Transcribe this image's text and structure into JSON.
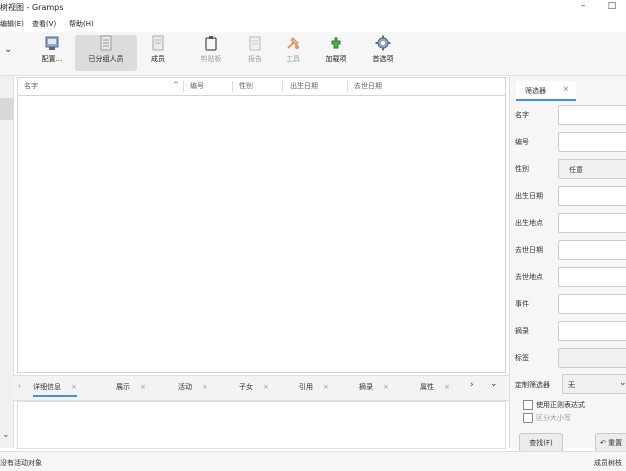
{
  "window": {
    "title": "树视图 - Gramps",
    "minimize": "–",
    "maximize": "□"
  },
  "menu": [
    "编辑(E)",
    "查看(V)",
    "帮助(H)"
  ],
  "toolbar": {
    "left_chevron": "⌄",
    "items": [
      {
        "label": "配置...",
        "icon": "configure-icon",
        "enabled": true
      },
      {
        "label": "已分组人员",
        "icon": "grouped-people-icon",
        "enabled": true,
        "active": true
      },
      {
        "label": "成员",
        "icon": "members-icon",
        "enabled": true
      },
      {
        "label": "剪贴板",
        "icon": "clipboard-icon",
        "enabled": false
      },
      {
        "label": "报告",
        "icon": "report-icon",
        "enabled": false
      },
      {
        "label": "工具",
        "icon": "tools-icon",
        "enabled": false
      },
      {
        "label": "加载项",
        "icon": "addons-icon",
        "enabled": true
      },
      {
        "label": "首选项",
        "icon": "preferences-icon",
        "enabled": true
      }
    ]
  },
  "columns": [
    "名字",
    "编号",
    "性别",
    "出生日期",
    "去世日期"
  ],
  "sort_indicator": "^",
  "bottom_tabs": [
    {
      "label": "详细信息",
      "selected": true
    },
    {
      "label": "展示"
    },
    {
      "label": "活动"
    },
    {
      "label": "子女"
    },
    {
      "label": "引用"
    },
    {
      "label": "摘录"
    },
    {
      "label": "属性"
    }
  ],
  "bottom_nav": {
    "left": "‹",
    "right": "›",
    "menu": "⌄",
    "close": "×"
  },
  "sidebar": {
    "tab_label": "筛选器",
    "fields": [
      "名字",
      "编号",
      "性别",
      "出生日期",
      "出生地点",
      "去世日期",
      "去世地点",
      "事件",
      "摘录",
      "标签"
    ],
    "gender_value": "任意",
    "custom_filter_label": "定制筛选器",
    "custom_filter_value": "无",
    "checkbox_regex": "使用正则表达式",
    "checkbox_case": "区分大小写",
    "find_button": "查找(F)",
    "reset_button": "重置"
  },
  "status": {
    "left": "没有活动对象",
    "right": "成员树枝"
  }
}
